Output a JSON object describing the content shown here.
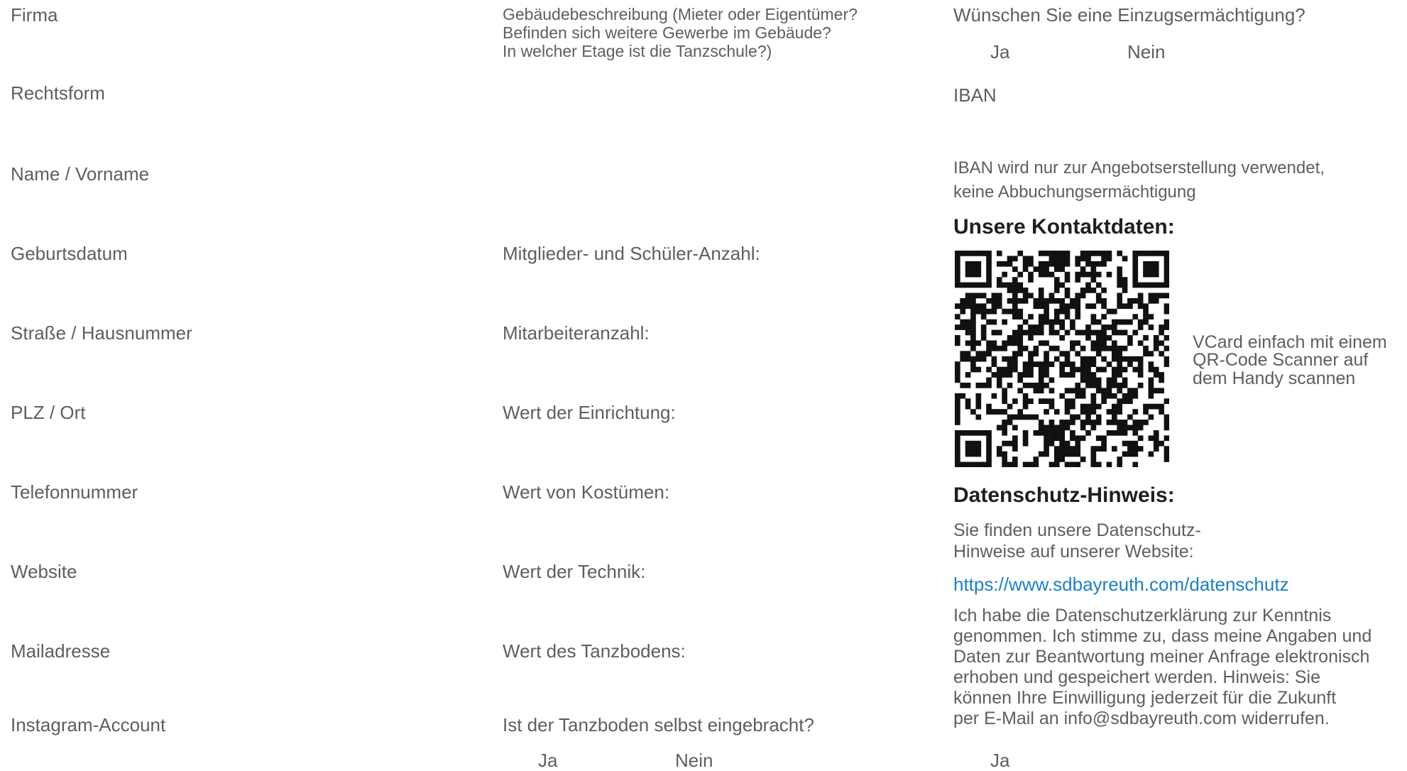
{
  "left_column": {
    "fields": [
      "Firma",
      "Rechtsform",
      "Name / Vorname",
      "Geburtsdatum",
      "Straße / Hausnummer",
      "PLZ / Ort",
      "Telefonnummer",
      "Website",
      "Mailadresse",
      "Instagram-Account"
    ]
  },
  "middle_column": {
    "building_description_lines": [
      "Gebäudebeschreibung (Mieter oder Eigentümer?",
      "Befinden sich weitere Gewerbe im Gebäude?",
      "In welcher Etage ist die Tanzschule?)"
    ],
    "fields": [
      "Mitglieder- und Schüler-Anzahl:",
      "Mitarbeiteranzahl:",
      "Wert der Einrichtung:",
      "Wert von Kostümen:",
      "Wert der Technik:",
      "Wert des Tanzbodens:",
      "Ist der Tanzboden selbst eingebracht?"
    ],
    "tanzboden_options": {
      "yes": "Ja",
      "no": "Nein"
    }
  },
  "right_column": {
    "direct_debit_question": "Wünschen Sie eine Einzugsermächtigung?",
    "direct_debit_options": {
      "yes": "Ja",
      "no": "Nein"
    },
    "iban_label": "IBAN",
    "iban_note_lines": [
      "IBAN wird nur zur Angebotserstellung verwendet,",
      "keine Abbuchungsermächtigung"
    ],
    "contact_heading": "Unsere Kontaktdaten:",
    "vcard_hint_lines": [
      "VCard einfach mit einem",
      "QR-Code Scanner auf",
      "dem Handy scannen"
    ],
    "privacy_heading": "Datenschutz-Hinweis:",
    "privacy_intro_lines": [
      "Sie finden unsere Datenschutz-",
      "Hinweise auf unserer Website:"
    ],
    "privacy_link": "https://www.sdbayreuth.com/datenschutz",
    "consent_lines": [
      "Ich habe die Datenschutzerklärung zur Kenntnis",
      "genommen. Ich stimme zu, dass meine Angaben und",
      "Daten zur Beantwortung meiner Anfrage elektronisch",
      "erhoben und gespeichert werden. Hinweis: Sie",
      "können Ihre Einwilligung jederzeit für die Zukunft",
      "per E-Mail an info@sdbayreuth.com widerrufen."
    ],
    "consent_option": "Ja"
  },
  "colors": {
    "text": "#5e5e5e",
    "heading": "#1f1f1f",
    "link": "#1e7fc2"
  }
}
